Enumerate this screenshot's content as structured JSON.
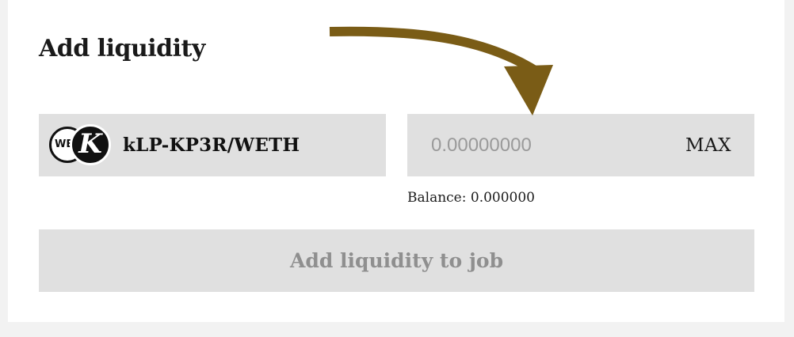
{
  "panel": {
    "title": "Add liquidity"
  },
  "token": {
    "name": "kLP-KP3R/WETH",
    "icon_weth": "WE",
    "icon_kp3r": "K"
  },
  "amount": {
    "placeholder": "0.00000000",
    "value": "",
    "max_label": "MAX"
  },
  "balance": {
    "label": "Balance:",
    "value": "0.000000"
  },
  "submit": {
    "label": "Add liquidity to job",
    "enabled": false
  },
  "annotation": {
    "arrow_color": "#7a5c16"
  },
  "colors": {
    "box_background": "#e0e0e0",
    "page_background": "#f2f2f2",
    "disabled_text": "#8f8f8f"
  }
}
